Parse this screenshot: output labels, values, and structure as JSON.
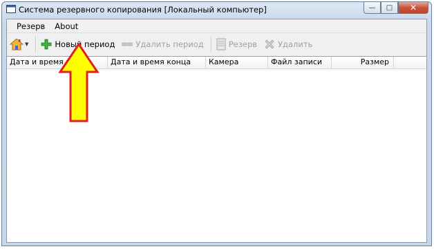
{
  "window": {
    "title": "Система резервного копирования [Локальный компьютер]",
    "buttons": {
      "minimize": "—",
      "maximize": "□",
      "close": "✕"
    }
  },
  "menu": [
    {
      "label": "Резерв"
    },
    {
      "label": "About"
    }
  ],
  "toolbar": {
    "home_icon": "home-icon",
    "new_period": {
      "label": "Новый период",
      "icon": "green-plus-icon",
      "enabled": true
    },
    "delete_period": {
      "label": "Удалить период",
      "icon": "minus-icon",
      "enabled": false
    },
    "backup": {
      "label": "Резерв",
      "icon": "document-icon",
      "enabled": false
    },
    "delete": {
      "label": "Удалить",
      "icon": "red-x-icon",
      "enabled": false
    }
  },
  "table": {
    "columns": [
      {
        "label": "Дата и время нач"
      },
      {
        "label": "Дата и время конца"
      },
      {
        "label": "Камера"
      },
      {
        "label": "Файл записи"
      },
      {
        "label": "Размер"
      },
      {
        "label": ""
      }
    ],
    "rows": []
  },
  "annotation": {
    "icon": "yellow-arrow-icon",
    "color": "#ffff00",
    "outline": "#e02020"
  }
}
